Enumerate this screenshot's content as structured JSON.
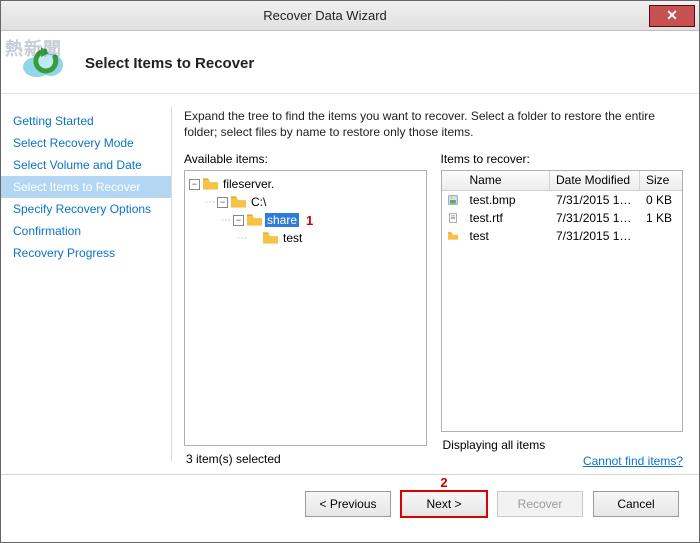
{
  "window": {
    "title": "Recover Data Wizard"
  },
  "header": {
    "page_title": "Select Items to Recover"
  },
  "sidebar": {
    "items": [
      {
        "label": "Getting Started"
      },
      {
        "label": "Select Recovery Mode"
      },
      {
        "label": "Select Volume and Date"
      },
      {
        "label": "Select Items to Recover"
      },
      {
        "label": "Specify Recovery Options"
      },
      {
        "label": "Confirmation"
      },
      {
        "label": "Recovery Progress"
      }
    ],
    "active_index": 3
  },
  "main": {
    "instructions": "Expand the tree to find the items you want to recover. Select a folder to restore the entire folder; select files by name to restore only those items.",
    "available_label": "Available items:",
    "recover_label": "Items to recover:",
    "tree": {
      "root": {
        "label": "fileserver.",
        "expanded": true
      },
      "drive": {
        "label": "C:\\",
        "expanded": true
      },
      "share": {
        "label": "share",
        "expanded": true,
        "selected": true
      },
      "test": {
        "label": "test"
      }
    },
    "grid": {
      "columns": {
        "name": "Name",
        "date": "Date Modified",
        "size": "Size"
      },
      "rows": [
        {
          "icon": "bmp",
          "name": "test.bmp",
          "date": "7/31/2015 12:1...",
          "size": "0 KB"
        },
        {
          "icon": "rtf",
          "name": "test.rtf",
          "date": "7/31/2015 12:1...",
          "size": "1 KB"
        },
        {
          "icon": "folder",
          "name": "test",
          "date": "7/31/2015 12:1...",
          "size": ""
        }
      ]
    },
    "selected_status": "3 item(s) selected",
    "display_status": "Displaying all items",
    "help_link": "Cannot find items?"
  },
  "footer": {
    "previous": "< Previous",
    "next": "Next >",
    "recover": "Recover",
    "cancel": "Cancel"
  },
  "annotations": {
    "one": "1",
    "two": "2"
  },
  "watermark": "熱新聞"
}
